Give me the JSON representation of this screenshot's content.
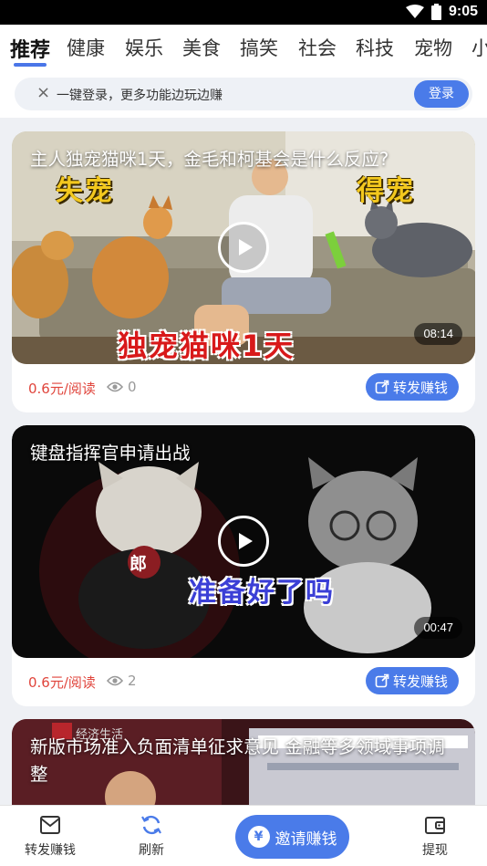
{
  "status_bar": {
    "time": "9:05"
  },
  "tabs": [
    {
      "label": "推荐",
      "active": true
    },
    {
      "label": "健康"
    },
    {
      "label": "娱乐"
    },
    {
      "label": "美食"
    },
    {
      "label": "搞笑"
    },
    {
      "label": "社会"
    },
    {
      "label": "科技"
    },
    {
      "label": "宠物"
    },
    {
      "label": "小"
    }
  ],
  "login_banner": {
    "close": "×",
    "text": "一键登录，更多功能边玩边赚",
    "button": "登录"
  },
  "feed": [
    {
      "title": "主人独宠猫咪1天，金毛和柯基会是什么反应?",
      "duration": "08:14",
      "overlay": {
        "left": "失宠",
        "right": "得宠",
        "bottom": "独宠猫咪1天"
      },
      "price": "0.6元/阅读",
      "views": "0",
      "share": "转发赚钱"
    },
    {
      "title": "键盘指挥官申请出战",
      "duration": "00:47",
      "overlay": {
        "center": "准备好了吗",
        "badge": "郎"
      },
      "price": "0.6元/阅读",
      "views": "2",
      "share": "转发赚钱"
    },
    {
      "title": "新版市场准入负面清单征求意见 金融等多领域事项调整",
      "source": "经济生活"
    }
  ],
  "bottom_nav": {
    "share": "转发赚钱",
    "refresh": "刷新",
    "invite": "邀请赚钱",
    "invite_symbol": "¥",
    "withdraw": "提现"
  },
  "colors": {
    "accent": "#4a7be9",
    "price": "#e0453c"
  }
}
